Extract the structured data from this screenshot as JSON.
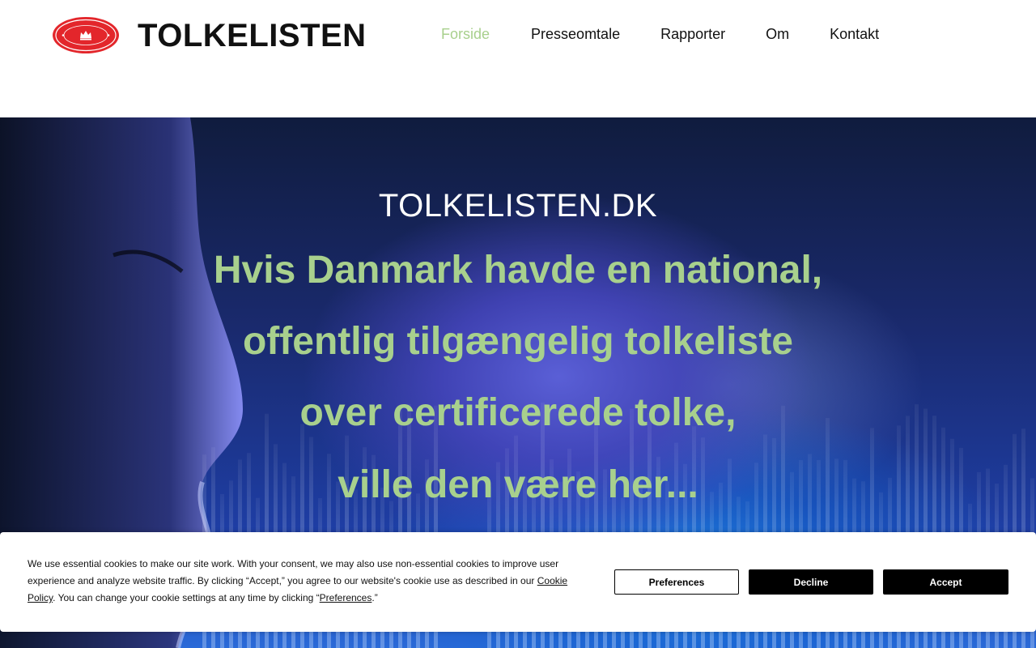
{
  "header": {
    "site_title": "TOLKELISTEN",
    "logo_text_top": "INTERPRETER REGI. DENM.",
    "logo_text_bottom": "TRANSLATOR DENMARK"
  },
  "nav": {
    "items": [
      {
        "label": "Forside",
        "active": true
      },
      {
        "label": "Presseomtale",
        "active": false
      },
      {
        "label": "Rapporter",
        "active": false
      },
      {
        "label": "Om",
        "active": false
      },
      {
        "label": "Kontakt",
        "active": false
      }
    ],
    "active_color": "#a8d08d"
  },
  "hero": {
    "subtitle": "TOLKELISTEN.DK",
    "lines": [
      "Hvis Danmark havde en national,",
      "offentlig tilgængelig tolkeliste",
      "over certificerede tolke,",
      "ville den være her..."
    ],
    "text_color": "#a8d08d"
  },
  "cookie": {
    "text_part1": "We use essential cookies to make our site work. With your consent, we may also use non-essential cookies to improve user experience and analyze website traffic. By clicking “Accept,” you agree to our website's cookie use as described in our ",
    "cookie_policy_link": "Cookie Policy",
    "text_part2": ". You can change your cookie settings at any time by clicking “",
    "preferences_link": "Preferences",
    "text_part3": ".”",
    "buttons": {
      "preferences": "Preferences",
      "decline": "Decline",
      "accept": "Accept"
    }
  }
}
